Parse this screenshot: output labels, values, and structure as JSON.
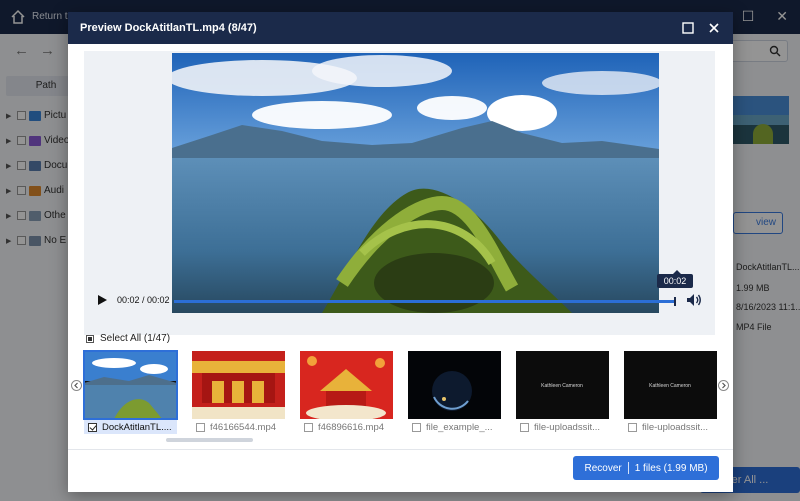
{
  "background": {
    "return_label": "Return to",
    "path_tab": "Path",
    "tree": [
      {
        "label": "Pictu",
        "icon": "image-folder-icon",
        "color": "#3a86d9"
      },
      {
        "label": "Video",
        "icon": "video-folder-icon",
        "color": "#8a5bd6"
      },
      {
        "label": "Docu",
        "icon": "document-folder-icon",
        "color": "#5b7fb0"
      },
      {
        "label": "Audi",
        "icon": "audio-folder-icon",
        "color": "#e08a2e"
      },
      {
        "label": "Othe",
        "icon": "other-folder-icon",
        "color": "#8aa0b8"
      },
      {
        "label": "No E",
        "icon": "no-extension-folder-icon",
        "color": "#7e93ad"
      }
    ],
    "preview_button": "view",
    "info": {
      "name": "DockAtitlanTL...",
      "size": "1.99 MB",
      "date": "8/16/2023 11:1...",
      "type": "MP4 File"
    },
    "recover_all": "er All ..."
  },
  "modal": {
    "title": "Preview DockAtitlanTL.mp4 (8/47)",
    "player": {
      "time": "00:02 / 00:02",
      "progress": 1.0,
      "tooltip": "00:02"
    },
    "select_all_label": "Select All (1/47)",
    "thumbnails": [
      {
        "name": "DockAtitlanTL....",
        "selected": true,
        "kind": "lake"
      },
      {
        "name": "f46166544.mp4",
        "selected": false,
        "kind": "festival"
      },
      {
        "name": "f46896616.mp4",
        "selected": false,
        "kind": "festival"
      },
      {
        "name": "file_example_...",
        "selected": false,
        "kind": "planet"
      },
      {
        "name": "file-uploadssit...",
        "selected": false,
        "kind": "text",
        "caption": "Kathleen Cameron"
      },
      {
        "name": "file-uploadssit...",
        "selected": false,
        "kind": "text",
        "caption": "Kathleen Cameron"
      }
    ],
    "recover_button": {
      "label": "Recover",
      "detail": "1 files (1.99 MB)"
    }
  },
  "colors": {
    "title_bar": "#1b2a4a",
    "accent": "#2e6fd8"
  }
}
